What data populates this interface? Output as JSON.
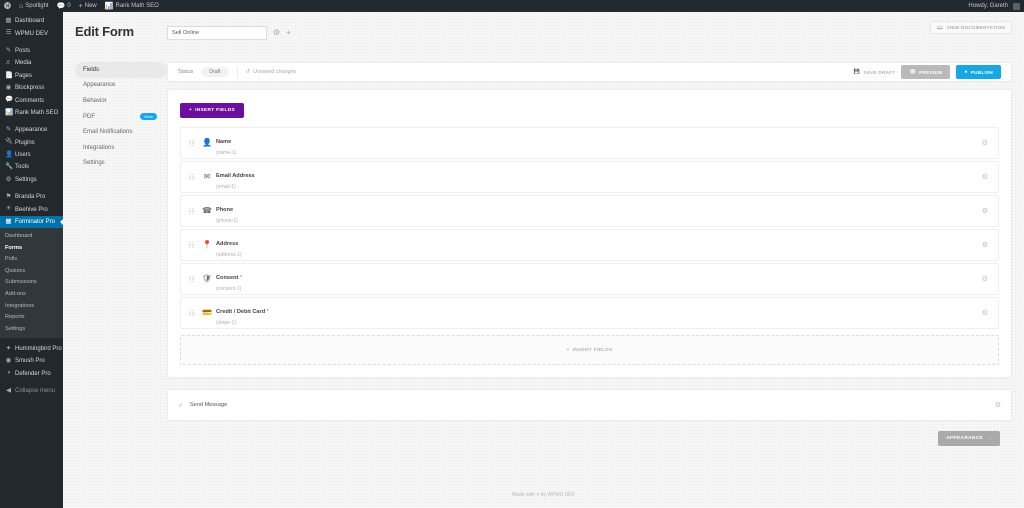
{
  "adminbar": {
    "logo_icon": "wordpress-icon",
    "items": [
      {
        "icon": "home-icon",
        "label": "Spotlight"
      },
      {
        "icon": "comment-icon",
        "label": "0"
      },
      {
        "icon": "plus-icon",
        "label": "New"
      },
      {
        "icon": "chart-icon",
        "label": "Rank Math SEO"
      }
    ],
    "account": "Howdy, Gareth"
  },
  "adminmenu": {
    "items": [
      {
        "icon": "dashboard-icon",
        "label": "Dashboard",
        "current": false
      },
      {
        "icon": "wpmu-icon",
        "label": "WPMU DEV",
        "current": false
      },
      {
        "sep": true
      },
      {
        "icon": "post-icon",
        "label": "Posts",
        "current": false
      },
      {
        "icon": "media-icon",
        "label": "Media",
        "current": false
      },
      {
        "icon": "page-icon",
        "label": "Pages",
        "current": false
      },
      {
        "icon": "blockpress-icon",
        "label": "Blockpress",
        "current": false
      },
      {
        "icon": "comment-icon",
        "label": "Comments",
        "current": false
      },
      {
        "icon": "chart-icon",
        "label": "Rank Math SEO",
        "current": false
      },
      {
        "sep": true
      },
      {
        "icon": "appearance-icon",
        "label": "Appearance",
        "current": false
      },
      {
        "icon": "plugins-icon",
        "label": "Plugins",
        "current": false
      },
      {
        "icon": "users-icon",
        "label": "Users",
        "current": false
      },
      {
        "icon": "tools-icon",
        "label": "Tools",
        "current": false
      },
      {
        "icon": "settings-icon",
        "label": "Settings",
        "current": false
      },
      {
        "sep": true
      },
      {
        "icon": "branda-icon",
        "label": "Branda Pro",
        "current": false
      },
      {
        "icon": "beehive-icon",
        "label": "Beehive Pro",
        "current": false
      },
      {
        "icon": "forminator-icon",
        "label": "Forminator Pro",
        "current": true
      }
    ],
    "submenu": [
      {
        "label": "Dashboard",
        "current": false
      },
      {
        "label": "Forms",
        "current": true
      },
      {
        "label": "Polls",
        "current": false
      },
      {
        "label": "Quizzes",
        "current": false
      },
      {
        "label": "Submissions",
        "current": false
      },
      {
        "label": "Add-ons",
        "current": false
      },
      {
        "label": "Integrations",
        "current": false
      },
      {
        "label": "Reports",
        "current": false
      },
      {
        "label": "Settings",
        "current": false
      }
    ],
    "items_after": [
      {
        "icon": "hummingbird-icon",
        "label": "Hummingbird Pro"
      },
      {
        "icon": "smush-icon",
        "label": "Smush Pro"
      },
      {
        "icon": "defender-icon",
        "label": "Defender Pro"
      },
      {
        "sep": true
      },
      {
        "icon": "collapse-icon",
        "label": "Collapse menu"
      }
    ]
  },
  "header": {
    "title": "Edit Form",
    "form_name_value": "Sell Online",
    "form_name_placeholder": "Form name",
    "settings_icon": "gear-icon",
    "add_icon": "plus-icon",
    "doc_button": "VIEW DOCUMENTATION",
    "doc_icon": "book-icon"
  },
  "tabs": [
    {
      "label": "Fields",
      "active": true,
      "badge": ""
    },
    {
      "label": "Appearance",
      "active": false,
      "badge": ""
    },
    {
      "label": "Behavior",
      "active": false,
      "badge": ""
    },
    {
      "label": "PDF",
      "active": false,
      "badge": "New"
    },
    {
      "label": "Email Notifications",
      "active": false,
      "badge": ""
    },
    {
      "label": "Integrations",
      "active": false,
      "badge": ""
    },
    {
      "label": "Settings",
      "active": false,
      "badge": ""
    }
  ],
  "status": {
    "label": "Status",
    "value": "Draft",
    "unsaved_icon": "refresh-icon",
    "unsaved_text": "Unsaved changes",
    "save_draft": "SAVE DRAFT",
    "save_draft_icon": "save-icon",
    "preview": "PREVIEW",
    "preview_icon": "eye-icon",
    "publish": "PUBLISH",
    "publish_icon": "publish-icon"
  },
  "builder": {
    "insert_top": "INSERT FIELDS",
    "insert_top_icon": "plus-icon",
    "insert_bottom": "INSERT FIELDS",
    "insert_bottom_icon": "plus-icon",
    "fields": [
      {
        "icon": "person-icon",
        "label": "Name",
        "required": "",
        "slug": "(name-1)"
      },
      {
        "icon": "envelope-icon",
        "label": "Email Address",
        "required": "",
        "slug": "(email-1)"
      },
      {
        "icon": "phone-icon",
        "label": "Phone",
        "required": "",
        "slug": "(phone-1)"
      },
      {
        "icon": "map-pin-icon",
        "label": "Address",
        "required": "",
        "slug": "(address-1)"
      },
      {
        "icon": "shield-icon",
        "label": "Consent",
        "required": "*",
        "slug": "(consent-1)"
      },
      {
        "icon": "credit-card-icon",
        "label": "Credit / Debit Card",
        "required": "*",
        "slug": "(stripe-1)"
      }
    ],
    "gear_icon": "gear-icon",
    "submit_icon": "check-icon",
    "submit_label": "Send Message",
    "appearance_button": "APPEARANCE",
    "appearance_icon": "arrow-right-icon"
  },
  "footer": {
    "prefix": "Made with",
    "heart": "♥",
    "suffix": "by WPMU DEV"
  }
}
